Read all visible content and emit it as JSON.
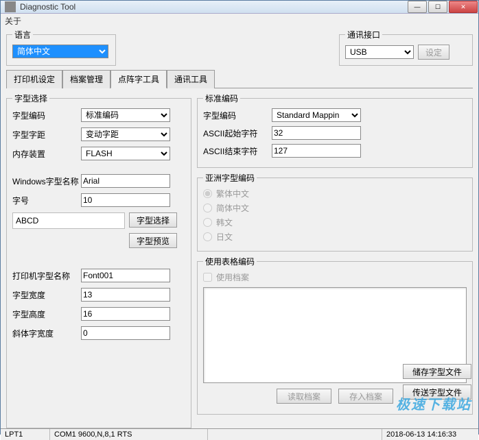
{
  "window": {
    "title": "Diagnostic Tool"
  },
  "menu": {
    "about": "关于"
  },
  "lang": {
    "legend": "语言",
    "value": "简体中文"
  },
  "comm": {
    "legend": "通讯接口",
    "value": "USB",
    "set_btn": "设定"
  },
  "tabs": {
    "t1": "打印机设定",
    "t2": "档案管理",
    "t3": "点阵字工具",
    "t4": "通讯工具"
  },
  "fontsel": {
    "legend": "字型选择",
    "encoding_label": "字型编码",
    "encoding_value": "标准编码",
    "pitch_label": "字型字距",
    "pitch_value": "变动字距",
    "storage_label": "内存装置",
    "storage_value": "FLASH",
    "winfont_label": "Windows字型名称",
    "winfont_value": "Arial",
    "size_label": "字号",
    "size_value": "10",
    "preview": "ABCD",
    "choose_btn": "字型选择",
    "preview_btn": "字型预览",
    "printer_font_label": "打印机字型名称",
    "printer_font_value": "Font001",
    "width_label": "字型宽度",
    "width_value": "13",
    "height_label": "字型高度",
    "height_value": "16",
    "italic_label": "斜体字宽度",
    "italic_value": "0"
  },
  "std": {
    "legend": "标准编码",
    "enc_label": "字型编码",
    "enc_value": "Standard Mappin",
    "start_label": "ASCII起始字符",
    "start_value": "32",
    "end_label": "ASCII结束字符",
    "end_value": "127"
  },
  "asia": {
    "legend": "亚洲字型编码",
    "trad": "繁体中文",
    "simp": "简体中文",
    "kor": "韩文",
    "jpn": "日文"
  },
  "table": {
    "legend": "使用表格编码",
    "use_file": "使用档案",
    "read_btn": "读取档案",
    "save_btn": "存入档案"
  },
  "actions": {
    "save_font": "储存字型文件",
    "send_font": "传送字型文件"
  },
  "status": {
    "port": "LPT1",
    "com": "COM1 9600,N,8,1 RTS",
    "time": "2018-06-13 14:16:33"
  },
  "watermark": "极速下载站"
}
